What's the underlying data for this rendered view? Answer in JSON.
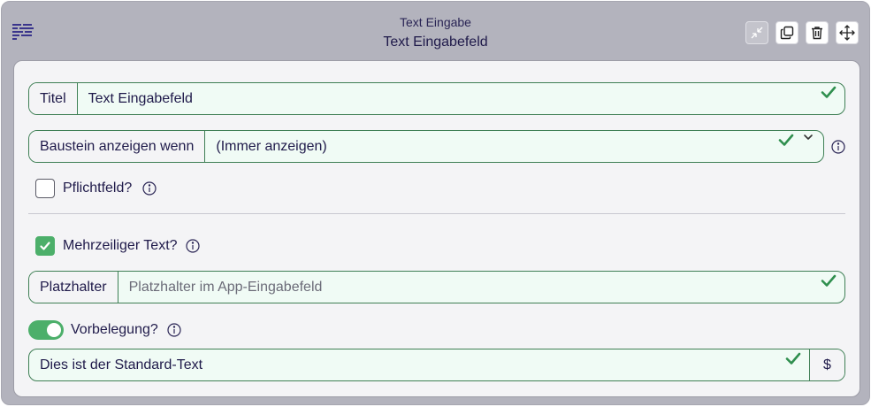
{
  "header": {
    "subtitle": "Text Eingabe",
    "title": "Text Eingabefeld"
  },
  "toolbar": {
    "collapse": "collapse-icon",
    "duplicate": "duplicate-icon",
    "delete": "trash-icon",
    "move": "move-icon"
  },
  "title_field": {
    "label": "Titel",
    "value": "Text Eingabefeld"
  },
  "condition_field": {
    "label": "Baustein anzeigen wenn",
    "value": "(Immer anzeigen)"
  },
  "required": {
    "label": "Pflichtfeld?",
    "checked": false
  },
  "multiline": {
    "label": "Mehrzeiliger Text?",
    "checked": true
  },
  "placeholder_field": {
    "label": "Platzhalter",
    "placeholder": "Platzhalter im App-Eingabefeld",
    "value": ""
  },
  "default_toggle": {
    "label": "Vorbelegung?",
    "on": true
  },
  "default_field": {
    "value": "Dies ist der Standard-Text",
    "addon": "$"
  },
  "colors": {
    "accent_green": "#4caf6a",
    "border_green": "#3f7f55",
    "text_primary": "#1f1a4a"
  }
}
